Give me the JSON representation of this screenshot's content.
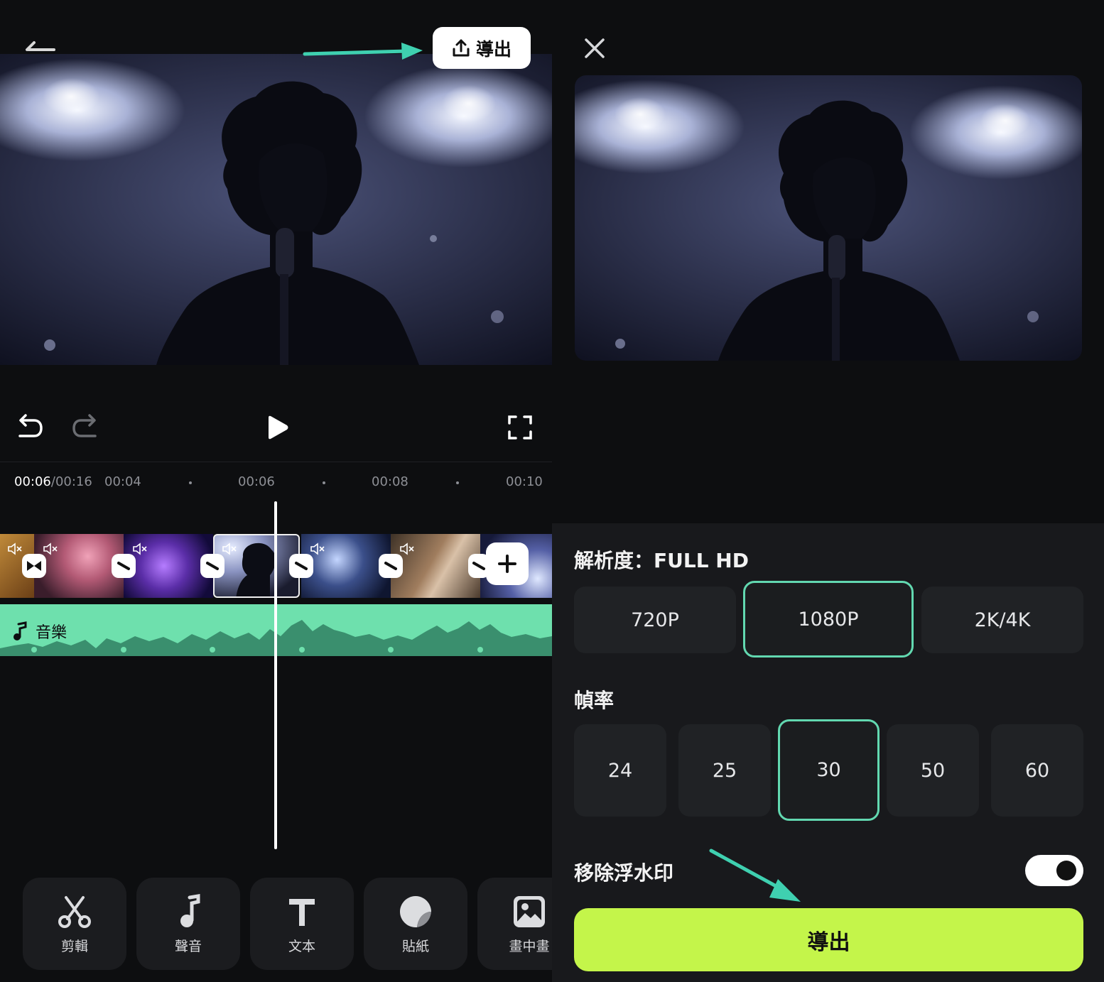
{
  "editor": {
    "export_button_label": "導出",
    "time_current": "00:06",
    "time_total": "/00:16",
    "ruler_ticks": [
      "00:04",
      "00:06",
      "00:08",
      "00:10"
    ],
    "music_track_label": "音樂",
    "tools": [
      {
        "label": "剪輯",
        "icon": "scissors-icon"
      },
      {
        "label": "聲音",
        "icon": "music-note-icon"
      },
      {
        "label": "文本",
        "icon": "text-icon"
      },
      {
        "label": "貼紙",
        "icon": "sticker-icon"
      },
      {
        "label": "畫中畫",
        "icon": "picture-in-picture-icon"
      }
    ]
  },
  "export_panel": {
    "resolution_title": "解析度：FULL HD",
    "resolutions": [
      "720P",
      "1080P",
      "2K/4K"
    ],
    "selected_resolution": "1080P",
    "framerate_title": "幀率",
    "framerates": [
      "24",
      "25",
      "30",
      "50",
      "60"
    ],
    "selected_framerate": "30",
    "watermark_label": "移除浮水印",
    "watermark_toggle_on": true,
    "export_button_label": "導出"
  },
  "colors": {
    "accent": "#62d8b0",
    "export_button": "#c4f54a",
    "music_track": "#6ee0ad",
    "annotation_arrow": "#3fd0b0"
  }
}
